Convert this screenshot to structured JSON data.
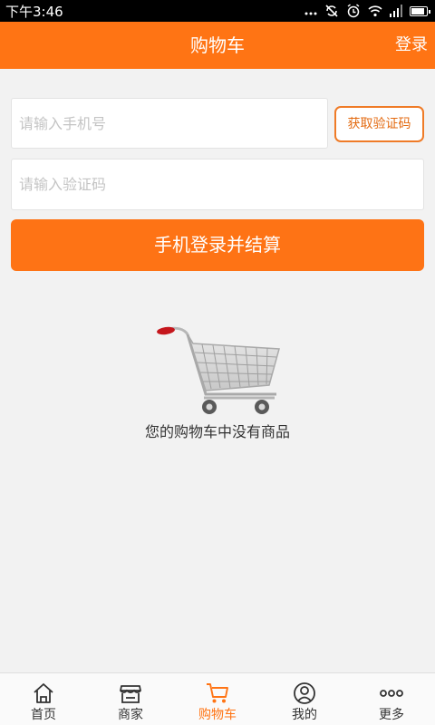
{
  "status_bar": {
    "time": "下午3:46",
    "icons": [
      "more-dots-icon",
      "sync-off-icon",
      "alarm-icon",
      "wifi-icon",
      "signal-icon",
      "battery-icon"
    ],
    "battery_level": 0.9
  },
  "header": {
    "title": "购物车",
    "login_label": "登录",
    "background_color": "#ff7414"
  },
  "login_form": {
    "phone_placeholder": "请输入手机号",
    "phone_value": "",
    "get_code_label": "获取验证码",
    "code_placeholder": "请输入验证码",
    "code_value": "",
    "submit_label": "手机登录并结算"
  },
  "empty_cart": {
    "illustration_icon": "shopping-cart-icon",
    "message": "您的购物车中没有商品"
  },
  "tab_bar": {
    "accent_color": "#ff7414",
    "items": [
      {
        "label": "首页",
        "icon": "home-icon",
        "active": false
      },
      {
        "label": "商家",
        "icon": "store-icon",
        "active": false
      },
      {
        "label": "购物车",
        "icon": "cart-icon",
        "active": true
      },
      {
        "label": "我的",
        "icon": "user-icon",
        "active": false
      },
      {
        "label": "更多",
        "icon": "more-icon",
        "active": false
      }
    ]
  }
}
